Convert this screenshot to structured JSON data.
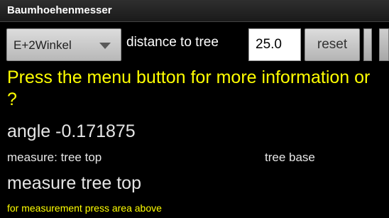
{
  "app": {
    "title": "Baumhoehenmesser"
  },
  "toolbar": {
    "mode_selected": "E+2Winkel",
    "distance_label": "distance to tree",
    "distance_value": "25.0",
    "reset_label": "reset"
  },
  "main": {
    "info_text": "Press the menu button for more information or ?",
    "angle_text": "angle -0.171875",
    "measure_top_label": "measure: tree top",
    "tree_base_label": "tree base",
    "measure_status": "measure tree top",
    "hint_text": "for measurement press area above"
  },
  "colors": {
    "background": "#000000",
    "accent_text": "#ffff00",
    "body_text": "#e6e6e6"
  },
  "icons": {
    "spinner_caret": "chevron-down-icon"
  }
}
